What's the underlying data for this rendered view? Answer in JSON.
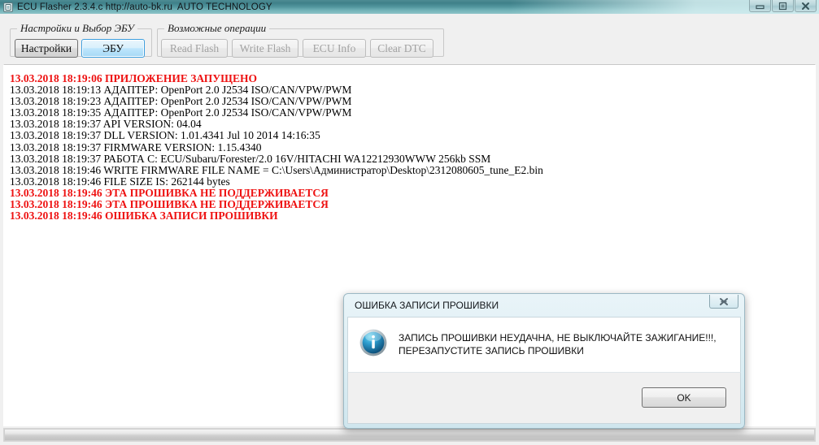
{
  "window": {
    "title": "ECU Flasher 2.3.4.c http://auto-bk.ru  AUTO TECHNOLOGY",
    "icon": "app-ecu-icon",
    "controls": {
      "minimize": "minimize-icon",
      "maximize": "maximize-icon",
      "close": "close-icon"
    }
  },
  "groups": {
    "settings": {
      "title": "Настройки и Выбор ЭБУ",
      "buttons": [
        {
          "label": "Настройки",
          "state": "normal"
        },
        {
          "label": "ЭБУ",
          "state": "focused"
        }
      ]
    },
    "operations": {
      "title": "Возможные операции",
      "buttons": [
        {
          "label": "Read Flash",
          "state": "disabled"
        },
        {
          "label": "Write Flash",
          "state": "disabled"
        },
        {
          "label": "ECU Info",
          "state": "disabled"
        },
        {
          "label": "Clear DTC",
          "state": "disabled"
        }
      ]
    }
  },
  "log": {
    "lines": [
      {
        "text": "13.03.2018 18:19:06 ПРИЛОЖЕНИЕ ЗАПУЩЕНО",
        "error": true
      },
      {
        "text": "13.03.2018 18:19:13 АДАПТЕР: OpenPort 2.0 J2534 ISO/CAN/VPW/PWM",
        "error": false
      },
      {
        "text": "13.03.2018 18:19:23 АДАПТЕР: OpenPort 2.0 J2534 ISO/CAN/VPW/PWM",
        "error": false
      },
      {
        "text": "13.03.2018 18:19:35 АДАПТЕР: OpenPort 2.0 J2534 ISO/CAN/VPW/PWM",
        "error": false
      },
      {
        "text": "13.03.2018 18:19:37 API VERSION: 04.04",
        "error": false
      },
      {
        "text": "13.03.2018 18:19:37 DLL VERSION: 1.01.4341 Jul 10 2014 14:16:35",
        "error": false
      },
      {
        "text": "13.03.2018 18:19:37 FIRMWARE VERSION: 1.15.4340",
        "error": false
      },
      {
        "text": "13.03.2018 18:19:37 РАБОТА С: ECU/Subaru/Forester/2.0 16V/HITACHI WA12212930WWW 256kb SSM",
        "error": false
      },
      {
        "text": "13.03.2018 18:19:46 WRITE FIRMWARE FILE NAME = C:\\Users\\Администратор\\Desktop\\2312080605_tune_E2.bin",
        "error": false
      },
      {
        "text": "13.03.2018 18:19:46 FILE SIZE IS: 262144 bytes",
        "error": false
      },
      {
        "text": "13.03.2018 18:19:46 ЭТА ПРОШИВКА НЕ ПОДДЕРЖИВАЕТСЯ",
        "error": true
      },
      {
        "text": "13.03.2018 18:19:46 ЭТА ПРОШИВКА НЕ ПОДДЕРЖИВАЕТСЯ",
        "error": true
      },
      {
        "text": "13.03.2018 18:19:46 ОШИБКА ЗАПИСИ ПРОШИВКИ",
        "error": true
      }
    ]
  },
  "dialog": {
    "title": "ОШИБКА ЗАПИСИ ПРОШИВКИ",
    "close_icon": "close-icon",
    "info_icon": "info-icon",
    "message": "ЗАПИСЬ ПРОШИВКИ НЕУДАЧНА, НЕ ВЫКЛЮЧАЙТЕ ЗАЖИГАНИЕ!!!,\nПЕРЕЗАПУСТИТЕ ЗАПИСЬ ПРОШИВКИ",
    "ok_label": "OK"
  },
  "colors": {
    "error_text": "#ee1111",
    "titlebar_teal": "#4e8b93",
    "focus_blue": "#3c9ede"
  }
}
